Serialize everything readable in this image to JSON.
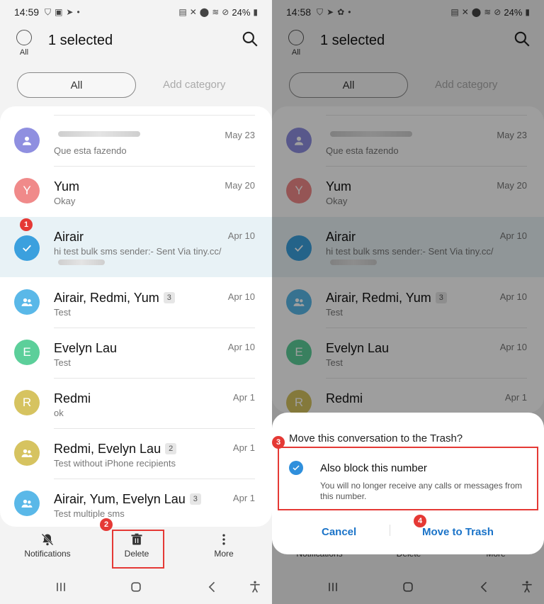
{
  "status_left": {
    "time": "14:59",
    "battery": "24%"
  },
  "status_right": {
    "time": "14:58",
    "battery": "24%"
  },
  "header": {
    "all_label": "All",
    "title": "1 selected"
  },
  "categories": {
    "all": "All",
    "add": "Add category"
  },
  "conversations": [
    {
      "name": "",
      "snippet": "Que esta fazendo",
      "date": "May 23",
      "avatar_letter": "",
      "avatar_color": "#8f8fe0",
      "avatar_icon": "person-icon"
    },
    {
      "name": "Yum",
      "snippet": "Okay",
      "date": "May 20",
      "avatar_letter": "Y",
      "avatar_color": "#f08a8a"
    },
    {
      "name": "Airair",
      "snippet": "hi test bulk sms sender:- Sent Via tiny.cc/",
      "date": "Apr 10",
      "avatar_color": "#3ba0de",
      "selected": true
    },
    {
      "name": "Airair, Redmi, Yum",
      "count": "3",
      "snippet": "Test",
      "date": "Apr 10",
      "avatar_color": "#5ab8e8",
      "avatar_icon": "group-icon"
    },
    {
      "name": "Evelyn Lau",
      "snippet": "Test",
      "date": "Apr 10",
      "avatar_letter": "E",
      "avatar_color": "#5ccf9a"
    },
    {
      "name": "Redmi",
      "snippet": "ok",
      "date": "Apr 1",
      "avatar_letter": "R",
      "avatar_color": "#d6c360"
    },
    {
      "name": "Redmi, Evelyn Lau",
      "count": "2",
      "snippet": "Test without iPhone recipients",
      "date": "Apr 1",
      "avatar_color": "#d6c360",
      "avatar_icon": "group-icon"
    },
    {
      "name": "Airair, Yum, Evelyn Lau",
      "count": "3",
      "snippet": "Test multiple sms",
      "date": "Apr 1",
      "avatar_color": "#5ab8e8",
      "avatar_icon": "group-icon"
    }
  ],
  "bottom_actions": {
    "notifications": "Notifications",
    "delete": "Delete",
    "more": "More"
  },
  "badges": {
    "b1": "1",
    "b2": "2",
    "b3": "3",
    "b4": "4"
  },
  "dialog": {
    "title": "Move this conversation to the Trash?",
    "option": "Also block this number",
    "description": "You will no longer receive any calls or messages from this number.",
    "cancel": "Cancel",
    "confirm": "Move to Trash"
  },
  "colors": {
    "accent": "#1a73c8",
    "highlight": "#e53935",
    "selected_row": "#e8f2f6"
  }
}
